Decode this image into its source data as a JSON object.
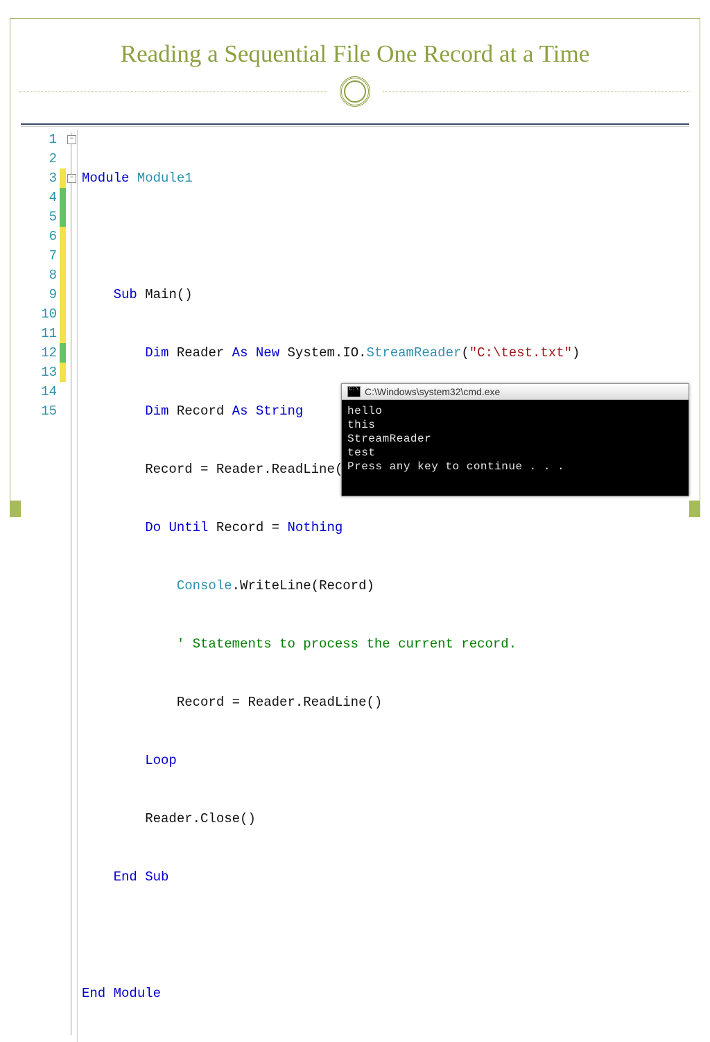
{
  "title": "Reading a Sequential File One Record at a Time",
  "code": {
    "line_count": 15,
    "change_bars": [
      "none",
      "none",
      "yellow",
      "green",
      "green",
      "yellow",
      "yellow",
      "yellow",
      "yellow",
      "yellow",
      "yellow",
      "green",
      "yellow",
      "none",
      "none"
    ],
    "folds": [
      {
        "line": 1
      },
      {
        "line": 3
      }
    ],
    "lines": {
      "l1_kw1": "Module",
      "l1_id": "Module1",
      "l3_kw1": "Sub",
      "l3_id": "Main",
      "l3_paren": "()",
      "l4_kw1": "Dim",
      "l4_id1": "Reader",
      "l4_kw2": "As",
      "l4_kw3": "New",
      "l4_sys": "System.IO.",
      "l4_typ": "StreamReader",
      "l4_p1": "(",
      "l4_str": "\"C:\\test.txt\"",
      "l4_p2": ")",
      "l5_kw1": "Dim",
      "l5_id1": "Record",
      "l5_kw2": "As",
      "l5_kw3": "String",
      "l6_txt": "Record = Reader.ReadLine()",
      "l7_kw1": "Do",
      "l7_kw2": "Until",
      "l7_mid": " Record = ",
      "l7_kw3": "Nothing",
      "l8_typ": "Console",
      "l8_txt": ".WriteLine(Record)",
      "l9_cmt": "' Statements to process the current record.",
      "l10_txt": "Record = Reader.ReadLine()",
      "l11_kw": "Loop",
      "l12_txt": "Reader.Close()",
      "l13_kw1": "End",
      "l13_kw2": "Sub",
      "l15_kw1": "End",
      "l15_kw2": "Module"
    }
  },
  "console": {
    "title": "C:\\Windows\\system32\\cmd.exe",
    "icon_text": "C:\\",
    "output": "hello\nthis\nStreamReader\ntest\nPress any key to continue . . ."
  }
}
